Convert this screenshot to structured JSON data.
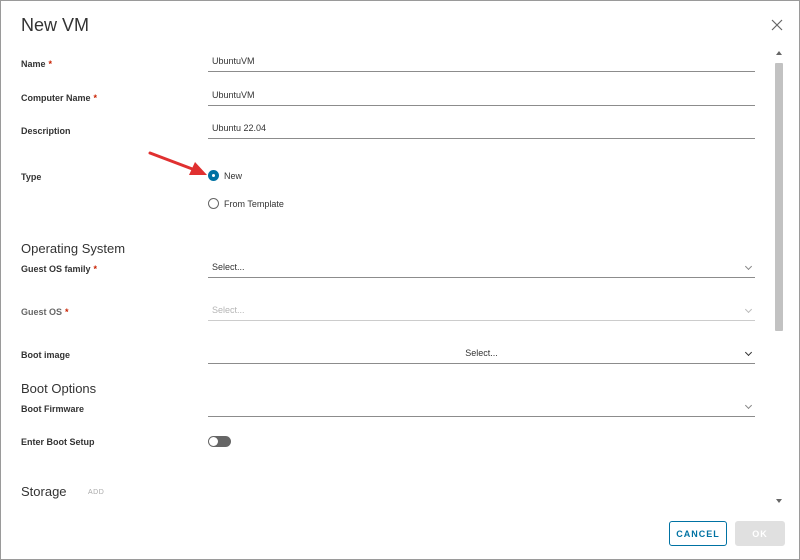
{
  "dialog": {
    "title": "New VM",
    "close_icon": "close-icon"
  },
  "form": {
    "name": {
      "label": "Name",
      "required": "*",
      "value": "UbuntuVM"
    },
    "computer_name": {
      "label": "Computer Name",
      "required": "*",
      "value": "UbuntuVM"
    },
    "description": {
      "label": "Description",
      "value": "Ubuntu 22.04"
    },
    "type": {
      "label": "Type",
      "options": [
        {
          "label": "New",
          "checked": true
        },
        {
          "label": "From Template",
          "checked": false
        }
      ]
    }
  },
  "operating_system": {
    "heading": "Operating System",
    "guest_os_family": {
      "label": "Guest OS family",
      "required": "*",
      "value": "Select..."
    },
    "guest_os": {
      "label": "Guest OS",
      "required": "*",
      "value": "Select..."
    },
    "boot_image": {
      "label": "Boot image",
      "value": "Select..."
    }
  },
  "boot_options": {
    "heading": "Boot Options",
    "boot_firmware": {
      "label": "Boot Firmware",
      "value": ""
    },
    "enter_boot_setup": {
      "label": "Enter Boot Setup",
      "enabled": false
    }
  },
  "storage": {
    "heading": "Storage",
    "add_label": "ADD"
  },
  "footer": {
    "cancel_label": "CANCEL",
    "ok_label": "OK"
  },
  "colors": {
    "accent": "#0072a3",
    "required": "#c92100",
    "annotation_arrow": "#e03030"
  }
}
